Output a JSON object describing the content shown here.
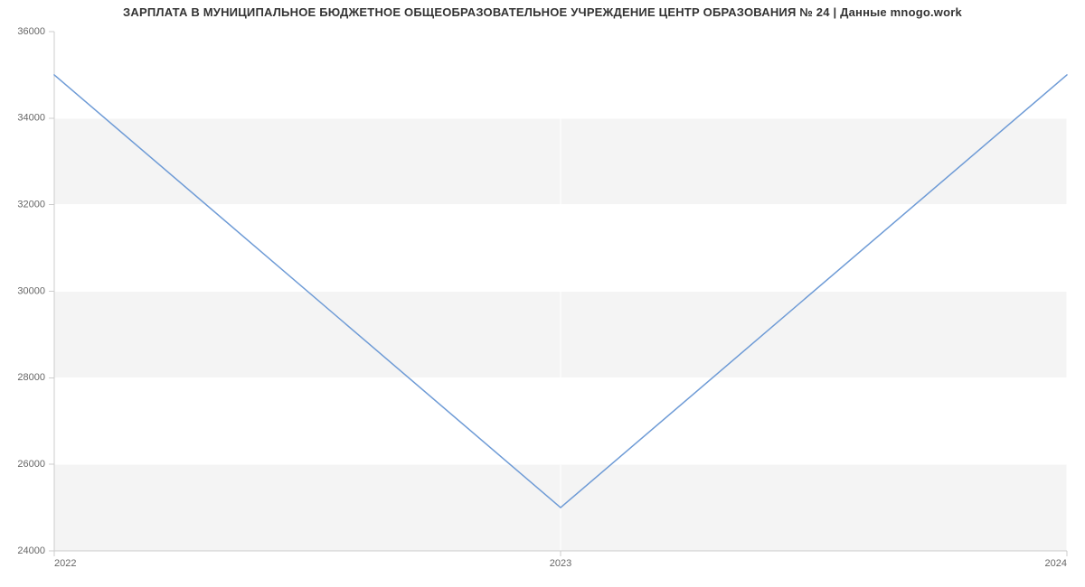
{
  "chart_data": {
    "type": "line",
    "title": "ЗАРПЛАТА В МУНИЦИПАЛЬНОЕ БЮДЖЕТНОЕ ОБЩЕОБРАЗОВАТЕЛЬНОЕ УЧРЕЖДЕНИЕ ЦЕНТР ОБРАЗОВАНИЯ № 24 | Данные mnogo.work",
    "xlabel": "",
    "ylabel": "",
    "x": [
      2022,
      2023,
      2024
    ],
    "values": [
      35000,
      25000,
      35000
    ],
    "x_ticks": [
      "2022",
      "2023",
      "2024"
    ],
    "y_ticks": [
      24000,
      26000,
      28000,
      30000,
      32000,
      34000,
      36000
    ],
    "ylim": [
      24000,
      36000
    ],
    "xlim": [
      2022,
      2024
    ],
    "grid": true,
    "line_color": "#6e9bd6"
  }
}
